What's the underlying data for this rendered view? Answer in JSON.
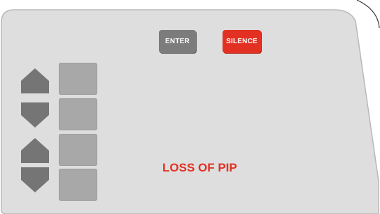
{
  "panel": {
    "enter_label": "ENTER",
    "silence_label": "SILENCE",
    "alarm_message": "LOSS OF PIP"
  },
  "colors": {
    "panel_bg": "#dedede",
    "panel_border": "#b8b8b8",
    "enter_button": "#7c7c7c",
    "silence_button": "#e23122",
    "alarm_text": "#e23122",
    "keypad_key": "#a8a8a8",
    "arrow_button": "#757575"
  },
  "icons": {
    "up_arrow": "up-arrow-icon",
    "down_arrow": "down-arrow-icon"
  }
}
